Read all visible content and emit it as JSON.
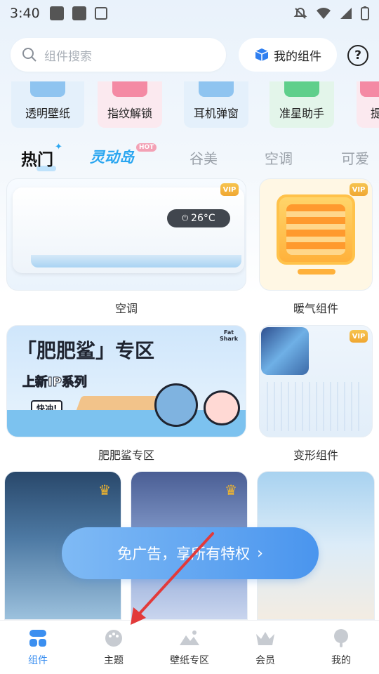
{
  "status_bar": {
    "time": "3:40"
  },
  "search": {
    "placeholder": "组件搜索"
  },
  "header": {
    "my_widgets_label": "我的组件",
    "help_label": "?"
  },
  "shortcuts": [
    {
      "label": "透明壁纸"
    },
    {
      "label": "指纹解锁"
    },
    {
      "label": "耳机弹窗"
    },
    {
      "label": "准星助手"
    },
    {
      "label": "提"
    }
  ],
  "tabs": [
    {
      "label": "热门"
    },
    {
      "label": "灵动岛",
      "badge": "HOT"
    },
    {
      "label": "谷美"
    },
    {
      "label": "空调"
    },
    {
      "label": "可爱"
    }
  ],
  "cards": {
    "ac": {
      "label": "空调",
      "display": "26°C",
      "vip": "VIP"
    },
    "heater": {
      "label": "暖气组件",
      "vip": "VIP"
    },
    "shark": {
      "label": "肥肥鲨专区",
      "title": "「肥肥鲨」专区",
      "subtitle": "上新IP系列",
      "cta": "快冲!",
      "logo": "Fat Shark"
    },
    "transform": {
      "label": "变形组件",
      "vip": "VIP"
    }
  },
  "promo": {
    "label": "免广告，享所有特权"
  },
  "bottom_nav": [
    {
      "label": "组件",
      "active": true
    },
    {
      "label": "主题",
      "active": false
    },
    {
      "label": "壁纸专区",
      "active": false
    },
    {
      "label": "会员",
      "active": false
    },
    {
      "label": "我的",
      "active": false
    }
  ],
  "colors": {
    "accent": "#3b8ff0",
    "island_tab": "#2aa6f0",
    "vip": "#f0a732",
    "annotation_arrow": "#e23a3a"
  }
}
